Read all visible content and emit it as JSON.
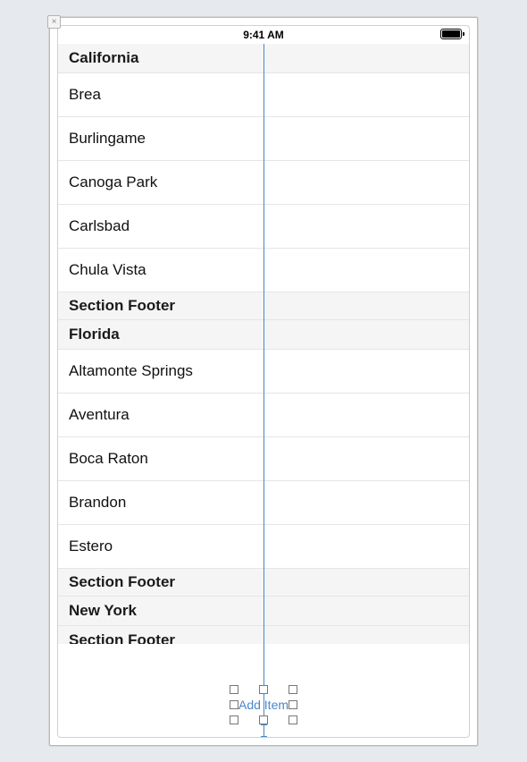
{
  "status_bar": {
    "time": "9:41 AM"
  },
  "sections": [
    {
      "header": "California",
      "rows": [
        "Brea",
        "Burlingame",
        "Canoga Park",
        "Carlsbad",
        "Chula Vista"
      ],
      "footer": "Section Footer"
    },
    {
      "header": "Florida",
      "rows": [
        "Altamonte Springs",
        "Aventura",
        "Boca Raton",
        "Brandon",
        "Estero"
      ],
      "footer": "Section Footer"
    },
    {
      "header": "New York",
      "rows": [],
      "footer": "Section Footer"
    }
  ],
  "editor": {
    "add_item_label": "Add Item"
  }
}
